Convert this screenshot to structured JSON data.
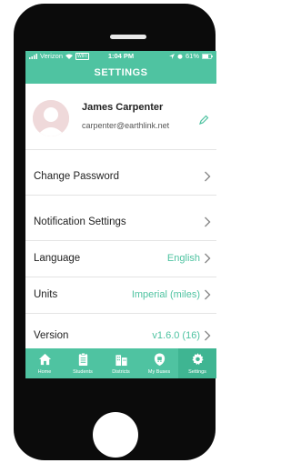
{
  "status_bar": {
    "carrier": "Verizon",
    "network": "WIFI",
    "time": "1:04 PM",
    "battery": "61%"
  },
  "header": {
    "title": "SETTINGS"
  },
  "profile": {
    "name": "James Carpenter",
    "email": "carpenter@earthlink.net"
  },
  "settings": {
    "change_password": "Change Password",
    "notification_settings": "Notification Settings",
    "language": {
      "label": "Language",
      "value": "English"
    },
    "units": {
      "label": "Units",
      "value": "Imperial (miles)"
    },
    "version": {
      "label": "Version",
      "value": "v1.6.0 (16)"
    }
  },
  "tabs": [
    {
      "label": "Home",
      "icon": "home-icon"
    },
    {
      "label": "Students",
      "icon": "clipboard-icon"
    },
    {
      "label": "Districts",
      "icon": "buildings-icon"
    },
    {
      "label": "My Buses",
      "icon": "bus-stop-icon"
    },
    {
      "label": "Settings",
      "icon": "gear-icon",
      "active": true
    }
  ],
  "colors": {
    "accent": "#4fc3a1",
    "active_tab": "#3fb592",
    "phone_body": "#0b0b0b"
  }
}
